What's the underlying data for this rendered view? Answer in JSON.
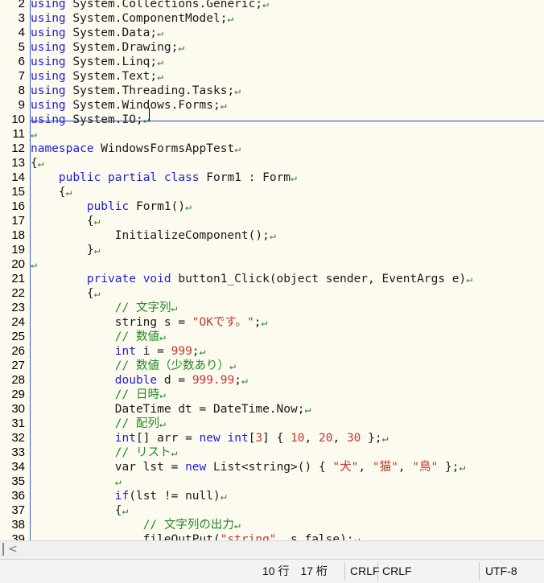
{
  "editor": {
    "lines": [
      {
        "n": "2",
        "segs": [
          {
            "c": "kw",
            "t": "using"
          },
          {
            "t": " System.Collections.Generic;"
          }
        ]
      },
      {
        "n": "3",
        "segs": [
          {
            "c": "kw",
            "t": "using"
          },
          {
            "t": " System.ComponentModel;"
          }
        ]
      },
      {
        "n": "4",
        "segs": [
          {
            "c": "kw",
            "t": "using"
          },
          {
            "t": " System.Data;"
          }
        ]
      },
      {
        "n": "5",
        "segs": [
          {
            "c": "kw",
            "t": "using"
          },
          {
            "t": " System.Drawing;"
          }
        ]
      },
      {
        "n": "6",
        "segs": [
          {
            "c": "kw",
            "t": "using"
          },
          {
            "t": " System.Linq;"
          }
        ]
      },
      {
        "n": "7",
        "segs": [
          {
            "c": "kw",
            "t": "using"
          },
          {
            "t": " System.Text;"
          }
        ]
      },
      {
        "n": "8",
        "segs": [
          {
            "c": "kw",
            "t": "using"
          },
          {
            "t": " System.Threading.Tasks;"
          }
        ]
      },
      {
        "n": "9",
        "segs": [
          {
            "c": "kw",
            "t": "using"
          },
          {
            "t": " System.Windows.Forms;"
          }
        ]
      },
      {
        "n": "10",
        "segs": [
          {
            "c": "kw",
            "t": "using"
          },
          {
            "t": " System.IO;"
          }
        ]
      },
      {
        "n": "11",
        "segs": []
      },
      {
        "n": "12",
        "segs": [
          {
            "c": "kw",
            "t": "namespace"
          },
          {
            "t": " WindowsFormsAppTest"
          }
        ]
      },
      {
        "n": "13",
        "segs": [
          {
            "t": "{"
          }
        ]
      },
      {
        "n": "14",
        "segs": [
          {
            "t": "    "
          },
          {
            "c": "kw",
            "t": "public"
          },
          {
            "t": " "
          },
          {
            "c": "kw",
            "t": "partial"
          },
          {
            "t": " "
          },
          {
            "c": "kw",
            "t": "class"
          },
          {
            "t": " Form1 : Form"
          }
        ]
      },
      {
        "n": "15",
        "segs": [
          {
            "t": "    {"
          }
        ]
      },
      {
        "n": "16",
        "segs": [
          {
            "t": "        "
          },
          {
            "c": "kw",
            "t": "public"
          },
          {
            "t": " Form1()"
          }
        ]
      },
      {
        "n": "17",
        "segs": [
          {
            "t": "        {"
          }
        ]
      },
      {
        "n": "18",
        "segs": [
          {
            "t": "            InitializeComponent();"
          }
        ]
      },
      {
        "n": "19",
        "segs": [
          {
            "t": "        }"
          }
        ]
      },
      {
        "n": "20",
        "segs": []
      },
      {
        "n": "21",
        "segs": [
          {
            "t": "        "
          },
          {
            "c": "kw",
            "t": "private"
          },
          {
            "t": " "
          },
          {
            "c": "kw",
            "t": "void"
          },
          {
            "t": " button1_Click(object sender, EventArgs e)"
          }
        ]
      },
      {
        "n": "22",
        "segs": [
          {
            "t": "        {"
          }
        ]
      },
      {
        "n": "23",
        "segs": [
          {
            "t": "            "
          },
          {
            "c": "cm",
            "t": "// 文字列"
          }
        ]
      },
      {
        "n": "24",
        "segs": [
          {
            "t": "            string s = "
          },
          {
            "c": "st",
            "t": "\"OKです。\""
          },
          {
            "t": ";"
          }
        ]
      },
      {
        "n": "25",
        "segs": [
          {
            "t": "            "
          },
          {
            "c": "cm",
            "t": "// 数値"
          }
        ]
      },
      {
        "n": "26",
        "segs": [
          {
            "t": "            "
          },
          {
            "c": "kw",
            "t": "int"
          },
          {
            "t": " i = "
          },
          {
            "c": "nm",
            "t": "999"
          },
          {
            "t": ";"
          }
        ]
      },
      {
        "n": "27",
        "segs": [
          {
            "t": "            "
          },
          {
            "c": "cm",
            "t": "// 数値（少数あり）"
          }
        ]
      },
      {
        "n": "28",
        "segs": [
          {
            "t": "            "
          },
          {
            "c": "kw",
            "t": "double"
          },
          {
            "t": " d = "
          },
          {
            "c": "nm",
            "t": "999.99"
          },
          {
            "t": ";"
          }
        ]
      },
      {
        "n": "29",
        "segs": [
          {
            "t": "            "
          },
          {
            "c": "cm",
            "t": "// 日時"
          }
        ]
      },
      {
        "n": "30",
        "segs": [
          {
            "t": "            DateTime dt = DateTime.Now;"
          }
        ]
      },
      {
        "n": "31",
        "segs": [
          {
            "t": "            "
          },
          {
            "c": "cm",
            "t": "// 配列"
          }
        ]
      },
      {
        "n": "32",
        "segs": [
          {
            "t": "            "
          },
          {
            "c": "kw",
            "t": "int"
          },
          {
            "t": "[] arr = "
          },
          {
            "c": "kw",
            "t": "new"
          },
          {
            "t": " "
          },
          {
            "c": "kw",
            "t": "int"
          },
          {
            "t": "["
          },
          {
            "c": "nm",
            "t": "3"
          },
          {
            "t": "] { "
          },
          {
            "c": "nm",
            "t": "10"
          },
          {
            "t": ", "
          },
          {
            "c": "nm",
            "t": "20"
          },
          {
            "t": ", "
          },
          {
            "c": "nm",
            "t": "30"
          },
          {
            "t": " };"
          }
        ]
      },
      {
        "n": "33",
        "segs": [
          {
            "t": "            "
          },
          {
            "c": "cm",
            "t": "// リスト"
          }
        ]
      },
      {
        "n": "34",
        "segs": [
          {
            "t": "            var lst = "
          },
          {
            "c": "kw",
            "t": "new"
          },
          {
            "t": " List<string>() { "
          },
          {
            "c": "st",
            "t": "\"犬\""
          },
          {
            "t": ", "
          },
          {
            "c": "st",
            "t": "\"猫\""
          },
          {
            "t": ", "
          },
          {
            "c": "st",
            "t": "\"鳥\""
          },
          {
            "t": " };"
          }
        ]
      },
      {
        "n": "35",
        "segs": [
          {
            "t": "            "
          }
        ]
      },
      {
        "n": "36",
        "segs": [
          {
            "t": "            "
          },
          {
            "c": "kw",
            "t": "if"
          },
          {
            "t": "(lst != null)"
          }
        ]
      },
      {
        "n": "37",
        "segs": [
          {
            "t": "            {"
          }
        ]
      },
      {
        "n": "38",
        "segs": [
          {
            "t": "                "
          },
          {
            "c": "cm",
            "t": "// 文字列の出力"
          }
        ]
      },
      {
        "n": "39",
        "segs": [
          {
            "t": "                fileOutPut("
          },
          {
            "c": "st",
            "t": "\"string\""
          },
          {
            "t": ", s,false);"
          }
        ]
      }
    ],
    "eol_mark": "↵",
    "hscroll_arrow": "<"
  },
  "status": {
    "position": "10 行　17 桁",
    "eol_1": "CRLF",
    "eol_2": "CRLF",
    "encoding": "UTF-8"
  },
  "colors": {
    "background": "#fdfaf0",
    "keyword": "#1f1fd6",
    "comment": "#208a20",
    "string": "#c0392b",
    "cursor_line": "#1f3fd0"
  }
}
